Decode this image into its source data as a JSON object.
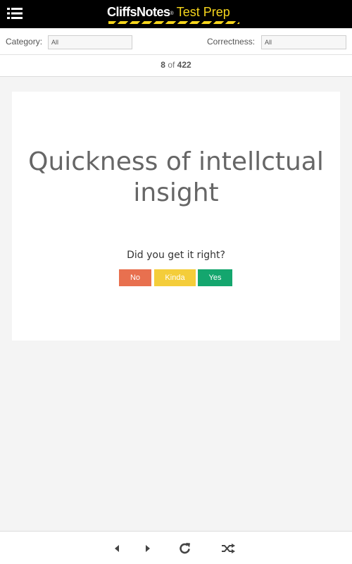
{
  "header": {
    "brand": "CliffsNotes",
    "registered": "®",
    "product": "Test Prep",
    "menu_icon": "list-menu-icon"
  },
  "filters": {
    "category_label": "Category:",
    "category_value": "All",
    "correctness_label": "Correctness:",
    "correctness_value": "All"
  },
  "counter": {
    "current": "8",
    "separator": "of",
    "total": "422"
  },
  "card": {
    "question": "Quickness of intellctual insight",
    "prompt": "Did you get it right?",
    "buttons": {
      "no": "No",
      "kinda": "Kinda",
      "yes": "Yes"
    },
    "colors": {
      "no": "#e8704f",
      "kinda": "#f4cd3a",
      "yes": "#14a66e"
    }
  },
  "footer": {
    "icons": [
      "previous-icon",
      "next-icon",
      "refresh-icon",
      "shuffle-icon"
    ]
  }
}
